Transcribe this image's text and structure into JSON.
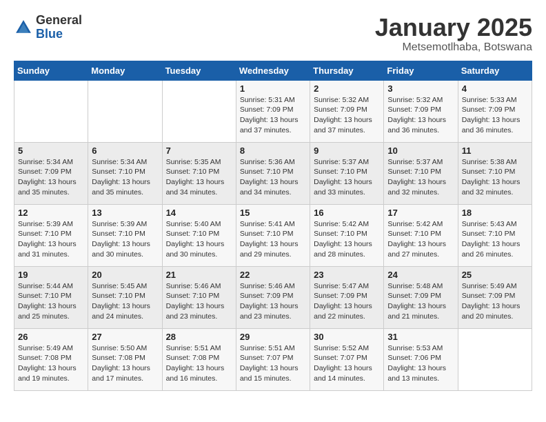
{
  "logo": {
    "general": "General",
    "blue": "Blue"
  },
  "header": {
    "title": "January 2025",
    "subtitle": "Metsemotlhaba, Botswana"
  },
  "days_of_week": [
    "Sunday",
    "Monday",
    "Tuesday",
    "Wednesday",
    "Thursday",
    "Friday",
    "Saturday"
  ],
  "weeks": [
    [
      {
        "day": "",
        "sunrise": "",
        "sunset": "",
        "daylight": ""
      },
      {
        "day": "",
        "sunrise": "",
        "sunset": "",
        "daylight": ""
      },
      {
        "day": "",
        "sunrise": "",
        "sunset": "",
        "daylight": ""
      },
      {
        "day": "1",
        "sunrise": "Sunrise: 5:31 AM",
        "sunset": "Sunset: 7:09 PM",
        "daylight": "Daylight: 13 hours and 37 minutes."
      },
      {
        "day": "2",
        "sunrise": "Sunrise: 5:32 AM",
        "sunset": "Sunset: 7:09 PM",
        "daylight": "Daylight: 13 hours and 37 minutes."
      },
      {
        "day": "3",
        "sunrise": "Sunrise: 5:32 AM",
        "sunset": "Sunset: 7:09 PM",
        "daylight": "Daylight: 13 hours and 36 minutes."
      },
      {
        "day": "4",
        "sunrise": "Sunrise: 5:33 AM",
        "sunset": "Sunset: 7:09 PM",
        "daylight": "Daylight: 13 hours and 36 minutes."
      }
    ],
    [
      {
        "day": "5",
        "sunrise": "Sunrise: 5:34 AM",
        "sunset": "Sunset: 7:09 PM",
        "daylight": "Daylight: 13 hours and 35 minutes."
      },
      {
        "day": "6",
        "sunrise": "Sunrise: 5:34 AM",
        "sunset": "Sunset: 7:10 PM",
        "daylight": "Daylight: 13 hours and 35 minutes."
      },
      {
        "day": "7",
        "sunrise": "Sunrise: 5:35 AM",
        "sunset": "Sunset: 7:10 PM",
        "daylight": "Daylight: 13 hours and 34 minutes."
      },
      {
        "day": "8",
        "sunrise": "Sunrise: 5:36 AM",
        "sunset": "Sunset: 7:10 PM",
        "daylight": "Daylight: 13 hours and 34 minutes."
      },
      {
        "day": "9",
        "sunrise": "Sunrise: 5:37 AM",
        "sunset": "Sunset: 7:10 PM",
        "daylight": "Daylight: 13 hours and 33 minutes."
      },
      {
        "day": "10",
        "sunrise": "Sunrise: 5:37 AM",
        "sunset": "Sunset: 7:10 PM",
        "daylight": "Daylight: 13 hours and 32 minutes."
      },
      {
        "day": "11",
        "sunrise": "Sunrise: 5:38 AM",
        "sunset": "Sunset: 7:10 PM",
        "daylight": "Daylight: 13 hours and 32 minutes."
      }
    ],
    [
      {
        "day": "12",
        "sunrise": "Sunrise: 5:39 AM",
        "sunset": "Sunset: 7:10 PM",
        "daylight": "Daylight: 13 hours and 31 minutes."
      },
      {
        "day": "13",
        "sunrise": "Sunrise: 5:39 AM",
        "sunset": "Sunset: 7:10 PM",
        "daylight": "Daylight: 13 hours and 30 minutes."
      },
      {
        "day": "14",
        "sunrise": "Sunrise: 5:40 AM",
        "sunset": "Sunset: 7:10 PM",
        "daylight": "Daylight: 13 hours and 30 minutes."
      },
      {
        "day": "15",
        "sunrise": "Sunrise: 5:41 AM",
        "sunset": "Sunset: 7:10 PM",
        "daylight": "Daylight: 13 hours and 29 minutes."
      },
      {
        "day": "16",
        "sunrise": "Sunrise: 5:42 AM",
        "sunset": "Sunset: 7:10 PM",
        "daylight": "Daylight: 13 hours and 28 minutes."
      },
      {
        "day": "17",
        "sunrise": "Sunrise: 5:42 AM",
        "sunset": "Sunset: 7:10 PM",
        "daylight": "Daylight: 13 hours and 27 minutes."
      },
      {
        "day": "18",
        "sunrise": "Sunrise: 5:43 AM",
        "sunset": "Sunset: 7:10 PM",
        "daylight": "Daylight: 13 hours and 26 minutes."
      }
    ],
    [
      {
        "day": "19",
        "sunrise": "Sunrise: 5:44 AM",
        "sunset": "Sunset: 7:10 PM",
        "daylight": "Daylight: 13 hours and 25 minutes."
      },
      {
        "day": "20",
        "sunrise": "Sunrise: 5:45 AM",
        "sunset": "Sunset: 7:10 PM",
        "daylight": "Daylight: 13 hours and 24 minutes."
      },
      {
        "day": "21",
        "sunrise": "Sunrise: 5:46 AM",
        "sunset": "Sunset: 7:10 PM",
        "daylight": "Daylight: 13 hours and 23 minutes."
      },
      {
        "day": "22",
        "sunrise": "Sunrise: 5:46 AM",
        "sunset": "Sunset: 7:09 PM",
        "daylight": "Daylight: 13 hours and 23 minutes."
      },
      {
        "day": "23",
        "sunrise": "Sunrise: 5:47 AM",
        "sunset": "Sunset: 7:09 PM",
        "daylight": "Daylight: 13 hours and 22 minutes."
      },
      {
        "day": "24",
        "sunrise": "Sunrise: 5:48 AM",
        "sunset": "Sunset: 7:09 PM",
        "daylight": "Daylight: 13 hours and 21 minutes."
      },
      {
        "day": "25",
        "sunrise": "Sunrise: 5:49 AM",
        "sunset": "Sunset: 7:09 PM",
        "daylight": "Daylight: 13 hours and 20 minutes."
      }
    ],
    [
      {
        "day": "26",
        "sunrise": "Sunrise: 5:49 AM",
        "sunset": "Sunset: 7:08 PM",
        "daylight": "Daylight: 13 hours and 19 minutes."
      },
      {
        "day": "27",
        "sunrise": "Sunrise: 5:50 AM",
        "sunset": "Sunset: 7:08 PM",
        "daylight": "Daylight: 13 hours and 17 minutes."
      },
      {
        "day": "28",
        "sunrise": "Sunrise: 5:51 AM",
        "sunset": "Sunset: 7:08 PM",
        "daylight": "Daylight: 13 hours and 16 minutes."
      },
      {
        "day": "29",
        "sunrise": "Sunrise: 5:51 AM",
        "sunset": "Sunset: 7:07 PM",
        "daylight": "Daylight: 13 hours and 15 minutes."
      },
      {
        "day": "30",
        "sunrise": "Sunrise: 5:52 AM",
        "sunset": "Sunset: 7:07 PM",
        "daylight": "Daylight: 13 hours and 14 minutes."
      },
      {
        "day": "31",
        "sunrise": "Sunrise: 5:53 AM",
        "sunset": "Sunset: 7:06 PM",
        "daylight": "Daylight: 13 hours and 13 minutes."
      },
      {
        "day": "",
        "sunrise": "",
        "sunset": "",
        "daylight": ""
      }
    ]
  ]
}
